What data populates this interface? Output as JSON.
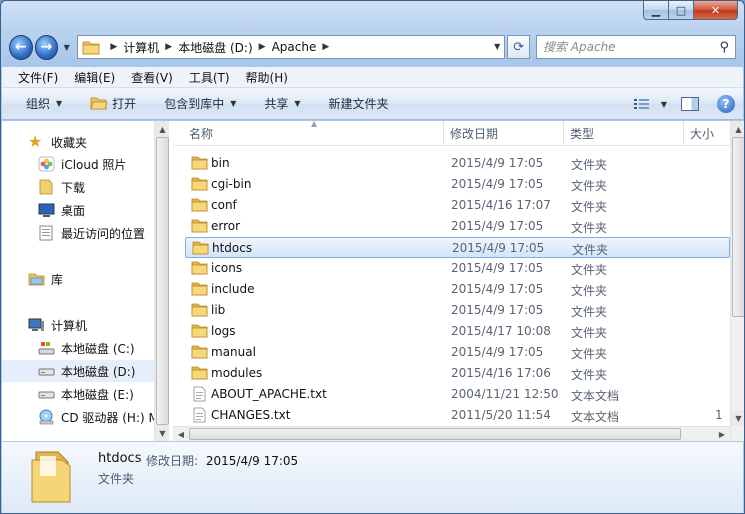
{
  "window": {
    "caption": {
      "minimize": "▁",
      "maximize": "□",
      "close": "✕"
    }
  },
  "address": {
    "back_icon": "back-arrow-icon",
    "forward_icon": "forward-arrow-icon",
    "breadcrumbs": [
      "计算机",
      "本地磁盘 (D:)",
      "Apache"
    ],
    "search_placeholder": "搜索 Apache"
  },
  "menu": [
    "文件(F)",
    "编辑(E)",
    "查看(V)",
    "工具(T)",
    "帮助(H)"
  ],
  "toolbar": {
    "organize": "组织",
    "open": "打开",
    "include_library": "包含到库中",
    "share": "共享",
    "new_folder": "新建文件夹"
  },
  "nav": {
    "favorites": "收藏夹",
    "icloud": "iCloud 照片",
    "downloads": "下载",
    "desktop": "桌面",
    "recent": "最近访问的位置",
    "libraries": "库",
    "computer": "计算机",
    "drive_c": "本地磁盘 (C:)",
    "drive_d": "本地磁盘 (D:)",
    "drive_e": "本地磁盘 (E:)",
    "cd_drive": "CD 驱动器 (H:) M"
  },
  "columns": {
    "name": "名称",
    "modified": "修改日期",
    "type": "类型",
    "size": "大小"
  },
  "files": [
    {
      "name": "bin",
      "modified": "2015/4/9 17:05",
      "type": "文件夹",
      "size": "",
      "icon": "folder-icon"
    },
    {
      "name": "cgi-bin",
      "modified": "2015/4/9 17:05",
      "type": "文件夹",
      "size": "",
      "icon": "folder-icon"
    },
    {
      "name": "conf",
      "modified": "2015/4/16 17:07",
      "type": "文件夹",
      "size": "",
      "icon": "folder-icon"
    },
    {
      "name": "error",
      "modified": "2015/4/9 17:05",
      "type": "文件夹",
      "size": "",
      "icon": "folder-icon"
    },
    {
      "name": "htdocs",
      "modified": "2015/4/9 17:05",
      "type": "文件夹",
      "size": "",
      "icon": "folder-icon",
      "selected": true
    },
    {
      "name": "icons",
      "modified": "2015/4/9 17:05",
      "type": "文件夹",
      "size": "",
      "icon": "folder-icon"
    },
    {
      "name": "include",
      "modified": "2015/4/9 17:05",
      "type": "文件夹",
      "size": "",
      "icon": "folder-icon"
    },
    {
      "name": "lib",
      "modified": "2015/4/9 17:05",
      "type": "文件夹",
      "size": "",
      "icon": "folder-icon"
    },
    {
      "name": "logs",
      "modified": "2015/4/17 10:08",
      "type": "文件夹",
      "size": "",
      "icon": "folder-icon"
    },
    {
      "name": "manual",
      "modified": "2015/4/9 17:05",
      "type": "文件夹",
      "size": "",
      "icon": "folder-icon"
    },
    {
      "name": "modules",
      "modified": "2015/4/16 17:06",
      "type": "文件夹",
      "size": "",
      "icon": "folder-icon"
    },
    {
      "name": "ABOUT_APACHE.txt",
      "modified": "2004/11/21 12:50",
      "type": "文本文档",
      "size": "",
      "icon": "text-file-icon"
    },
    {
      "name": "CHANGES.txt",
      "modified": "2011/5/20 11:54",
      "type": "文本文档",
      "size": "1",
      "icon": "text-file-icon"
    }
  ],
  "details": {
    "name": "htdocs",
    "modified_label": "修改日期:",
    "modified_value": "2015/4/9 17:05",
    "type": "文件夹"
  }
}
